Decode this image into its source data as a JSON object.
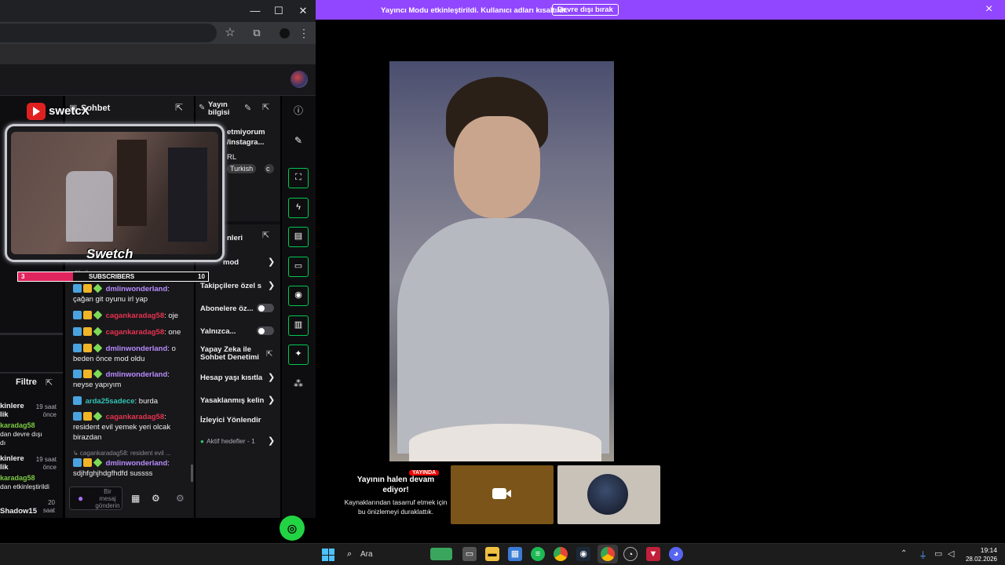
{
  "mod_banner": {
    "message": "Yayıncı Modu etkinleştirildi. Kullanıcı adları kısaltıldı.",
    "button": "Devre dışı bırak",
    "close": "×"
  },
  "browser": {
    "minimize": "—",
    "maximize": "☐",
    "close": "✕",
    "star": "☆",
    "extensions": "⧉",
    "menu": "⋮"
  },
  "overlay": {
    "channel": "swetcX",
    "logo_text": "Swetch",
    "sub_label": "SUBSCRIBERS",
    "sub_current": "3",
    "sub_goal": "10"
  },
  "left_panel": {
    "filter_label": "Filtre",
    "items": [
      {
        "title": "kinlere\nlik",
        "time": "19 saat\nönce",
        "user": "karadag58",
        "desc": "dan devre dışı\ndı"
      },
      {
        "title": "kinlere\nlik",
        "time": "19 saat\nönce",
        "user": "karadag58",
        "desc": "dan etkinleştirildi"
      },
      {
        "title": "Shadow15",
        "time": "20\nsaat"
      }
    ]
  },
  "chat": {
    "title": "Sohbet",
    "partial_top": "dönüş",
    "messages": [
      {
        "user": "dmlinwonderland",
        "color": "purple",
        "text": "çağan git oyunu irl yap"
      },
      {
        "user": "cagankaradag58",
        "color": "red",
        "text": "oje"
      },
      {
        "user": "cagankaradag58",
        "color": "red",
        "text": "one"
      },
      {
        "user": "dmlinwonderland",
        "color": "purple",
        "text": "o beden önce mod oldu"
      },
      {
        "user": "dmlinwonderland",
        "color": "purple",
        "text": "neyse yapıyım"
      },
      {
        "user": "arda25sadece",
        "color": "teal",
        "text": "burda"
      },
      {
        "user": "cagankaradag58",
        "color": "red",
        "text": "resident evil yemek yeri olcak birazdan"
      }
    ],
    "reply_ref": "↳ cagankaradag58: resident evil ...",
    "last_msg": {
      "user": "dmlinwonderland",
      "text": "sdjhfghjhdgfhdfd sussss"
    },
    "input_placeholder": "Bir mesaj gönderin"
  },
  "info_panel": {
    "title": "Yayın bilgisi",
    "title_lines": "etmiyorum\n/instagra...",
    "category": "RL",
    "tags": [
      "Turkish",
      "c"
    ],
    "section_title": "nleri",
    "rows": [
      {
        "label": "mod",
        "type": "chevron"
      },
      {
        "label": "Takipçilere özel s",
        "type": "chevron"
      },
      {
        "label": "Abonelere öz...",
        "type": "toggle"
      },
      {
        "label": "Yalnızca...",
        "type": "toggle"
      },
      {
        "label": "Yapay Zeka ile Sohbet Denetimi",
        "type": "external"
      },
      {
        "label": "Hesap yaşı kısıtla",
        "type": "chevron"
      },
      {
        "label": "Yasaklanmış kelin",
        "type": "chevron"
      },
      {
        "label": "İzleyici Yönlendir",
        "type": "none"
      },
      {
        "label": "Aktif hedefler - 1",
        "type": "chevron"
      }
    ]
  },
  "preview": {
    "live_badge": "YAYINDA",
    "status_title": "Yayının halen devam ediyor!",
    "status_desc": "Kaynaklarından tasarruf etmek için bu önizlemeyi duraklattık."
  },
  "taskbar": {
    "search_label": "Ara",
    "time": "19:14",
    "date": "28.02.2026"
  }
}
